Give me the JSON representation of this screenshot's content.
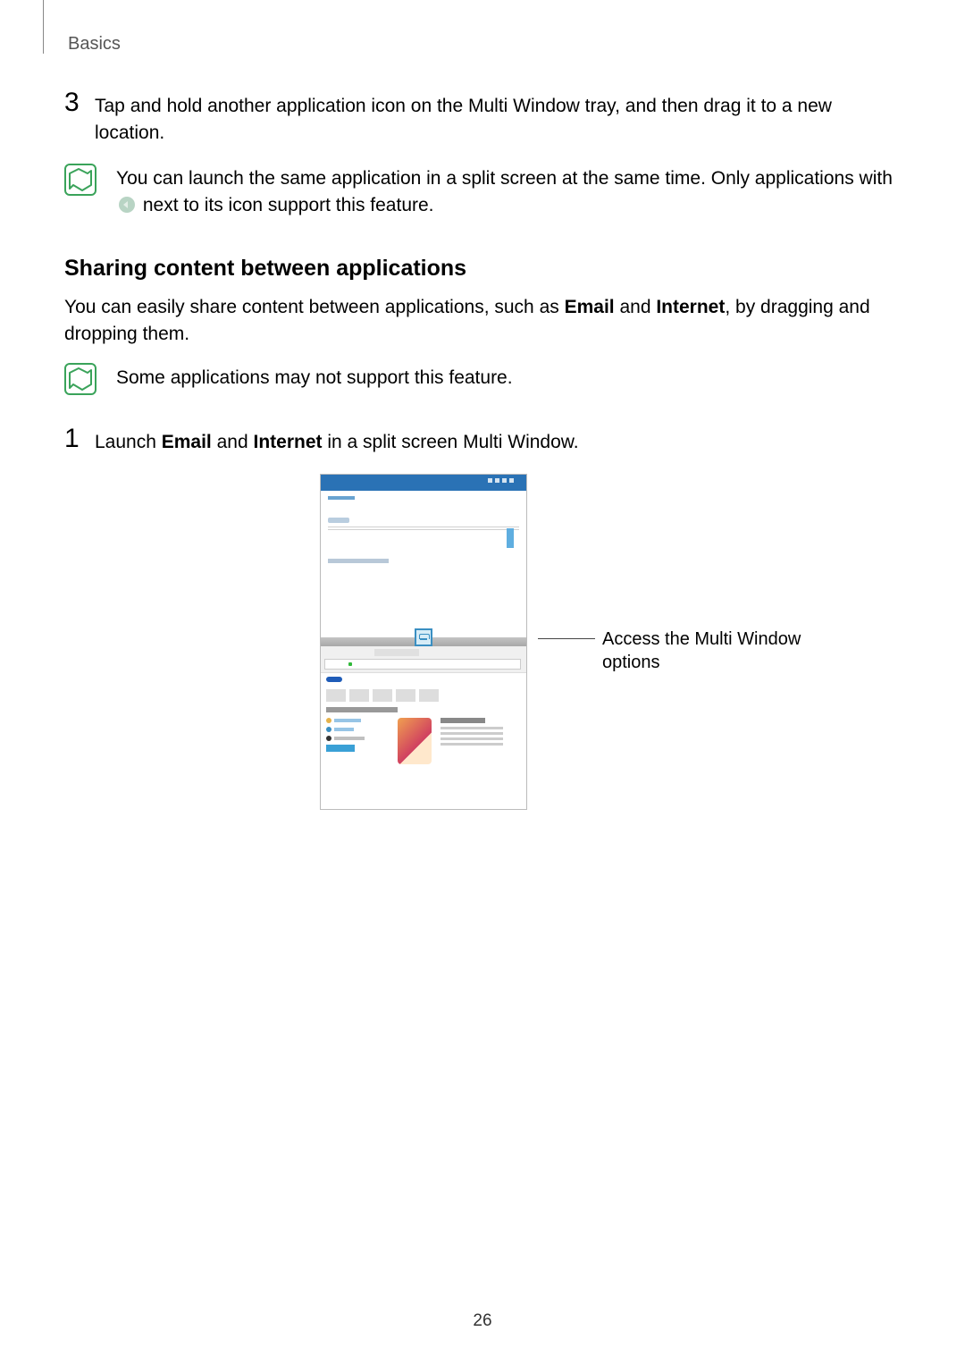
{
  "header": {
    "section": "Basics"
  },
  "step3": {
    "number": "3",
    "text": "Tap and hold another application icon on the Multi Window tray, and then drag it to a new location."
  },
  "note1": {
    "text_before": "You can launch the same application in a split screen at the same time. Only applications with ",
    "text_after": " next to its icon support this feature."
  },
  "section_title": "Sharing content between applications",
  "body1": {
    "pre": "You can easily share content between applications, such as ",
    "b1": "Email",
    "mid1": " and ",
    "b2": "Internet",
    "post": ", by dragging and dropping them."
  },
  "note2": {
    "text": "Some applications may not support this feature."
  },
  "step1": {
    "number": "1",
    "pre": "Launch ",
    "b1": "Email",
    "mid": " and ",
    "b2": "Internet",
    "post": " in a split screen Multi Window."
  },
  "callout": "Access the Multi Window options",
  "page_number": "26"
}
